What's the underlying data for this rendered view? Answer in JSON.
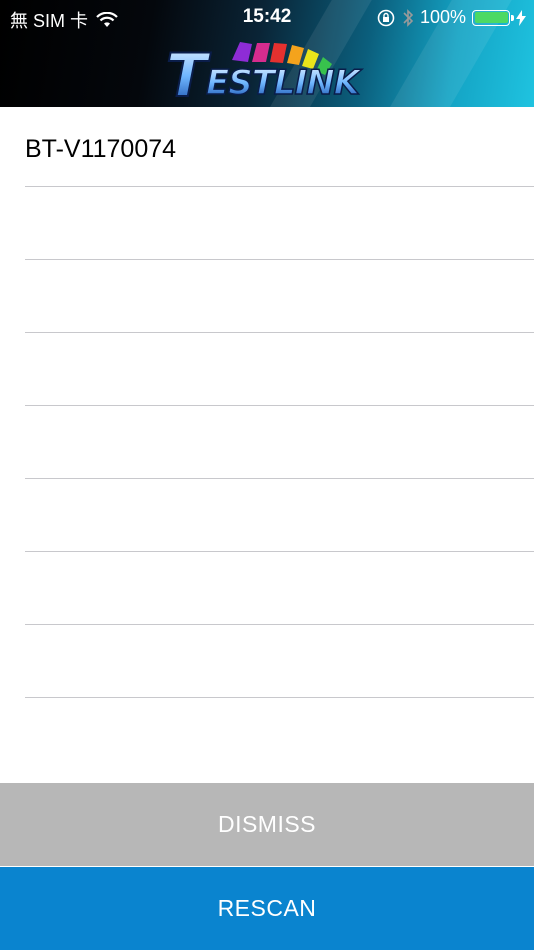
{
  "status_bar": {
    "carrier": "無 SIM 卡",
    "time": "15:42",
    "battery": "100%",
    "icons": [
      "wifi-icon",
      "orientation-lock-icon",
      "bluetooth-icon",
      "battery-icon",
      "charging-bolt-icon"
    ]
  },
  "header": {
    "logo_text": "TESTLINK",
    "logo_icon": "testlink-logo"
  },
  "device_list": {
    "items": [
      "BT-V1170074",
      "",
      "",
      "",
      "",
      "",
      "",
      "",
      ""
    ]
  },
  "buttons": {
    "dismiss": "DISMISS",
    "rescan": "RESCAN"
  },
  "colors": {
    "dismiss_bg": "#b7b7b7",
    "rescan_bg": "#0a84cf",
    "battery_fill": "#4cd964",
    "separator": "#c8c8cc"
  }
}
